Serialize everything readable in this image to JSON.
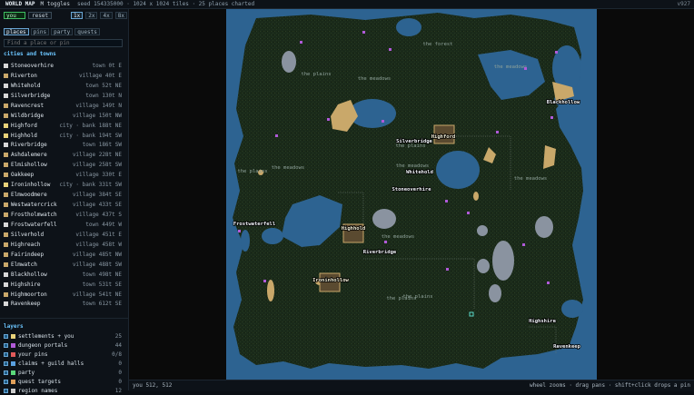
{
  "topbar": {
    "title": "WORLD MAP",
    "toggles": "M toggles",
    "seed": "seed 154335000 · 1024 x 1024 tiles · 25 places charted",
    "version": "v927"
  },
  "sidebar": {
    "you_value": "you",
    "reset_label": "reset",
    "zooms": [
      "1x",
      "2x",
      "4x",
      "8x"
    ],
    "active_zoom": 0,
    "tabs": [
      "places",
      "pins",
      "party",
      "quests"
    ],
    "active_tab": 0,
    "search_placeholder": "Find a place or pin",
    "places_heading": "cities and towns",
    "places": [
      {
        "name": "Stoneoverhire",
        "meta": "town 0t E",
        "color": "#d7d7d7"
      },
      {
        "name": "Riverton",
        "meta": "village 40t E",
        "color": "#c9a86a"
      },
      {
        "name": "Whitehold",
        "meta": "town 52t NE",
        "color": "#d7d7d7"
      },
      {
        "name": "Silverbridge",
        "meta": "town 130t N",
        "color": "#d7d7d7"
      },
      {
        "name": "Ravencrest",
        "meta": "village 149t N",
        "color": "#c9a86a"
      },
      {
        "name": "Wildbridge",
        "meta": "village 150t NW",
        "color": "#c9a86a"
      },
      {
        "name": "Highford",
        "meta": "city · bank 188t NE",
        "color": "#e8d27a"
      },
      {
        "name": "Highhold",
        "meta": "city · bank 194t SW",
        "color": "#e8d27a"
      },
      {
        "name": "Riverbridge",
        "meta": "town 186t SW",
        "color": "#d7d7d7"
      },
      {
        "name": "Ashdalemere",
        "meta": "village 228t NE",
        "color": "#c9a86a"
      },
      {
        "name": "Elmishollow",
        "meta": "village 258t SW",
        "color": "#c9a86a"
      },
      {
        "name": "Oakkeep",
        "meta": "village 330t E",
        "color": "#c9a86a"
      },
      {
        "name": "Ironinhollow",
        "meta": "city · bank 331t SW",
        "color": "#e8d27a"
      },
      {
        "name": "Elmwoodmere",
        "meta": "village 384t SE",
        "color": "#c9a86a"
      },
      {
        "name": "Westwatercrick",
        "meta": "village 433t SE",
        "color": "#c9a86a"
      },
      {
        "name": "Frostholmwatch",
        "meta": "village 437t S",
        "color": "#c9a86a"
      },
      {
        "name": "Frostwaterfell",
        "meta": "town 449t W",
        "color": "#d7d7d7"
      },
      {
        "name": "Silverhold",
        "meta": "village 451t E",
        "color": "#c9a86a"
      },
      {
        "name": "Highreach",
        "meta": "village 458t W",
        "color": "#c9a86a"
      },
      {
        "name": "Fairindeep",
        "meta": "village 485t NW",
        "color": "#c9a86a"
      },
      {
        "name": "Elmwatch",
        "meta": "village 488t SW",
        "color": "#c9a86a"
      },
      {
        "name": "Blackhollow",
        "meta": "town 498t NE",
        "color": "#d7d7d7"
      },
      {
        "name": "Highshire",
        "meta": "town 531t SE",
        "color": "#d7d7d7"
      },
      {
        "name": "Highmoorton",
        "meta": "village 541t NE",
        "color": "#c9a86a"
      },
      {
        "name": "Ravenkeep",
        "meta": "town 612t SE",
        "color": "#d7d7d7"
      }
    ],
    "layers_heading": "layers",
    "layers": [
      {
        "name": "settlements + you",
        "count": "25",
        "color": "#e8d27a"
      },
      {
        "name": "dungeon portals",
        "count": "44",
        "color": "#b05ad8"
      },
      {
        "name": "your pins",
        "count": "0/8",
        "color": "#e05a5a"
      },
      {
        "name": "claims + guild halls",
        "count": "0",
        "color": "#5aa0e0"
      },
      {
        "name": "party",
        "count": "0",
        "color": "#5ad87a"
      },
      {
        "name": "quest targets",
        "count": "0",
        "color": "#e0a05a"
      },
      {
        "name": "region names",
        "count": "12",
        "color": "#cccccc"
      }
    ]
  },
  "map": {
    "labels": [
      {
        "text": "the forest",
        "kind": "region"
      },
      {
        "text": "the plains",
        "kind": "region"
      },
      {
        "text": "the meadows",
        "kind": "region"
      },
      {
        "text": "the meadows",
        "kind": "region"
      },
      {
        "text": "the plains",
        "kind": "region"
      },
      {
        "text": "the plains",
        "kind": "region"
      },
      {
        "text": "the meadows",
        "kind": "region"
      },
      {
        "text": "the meadows",
        "kind": "region"
      },
      {
        "text": "the meadows",
        "kind": "region"
      },
      {
        "text": "the meadows",
        "kind": "region"
      },
      {
        "text": "the plains",
        "kind": "region"
      },
      {
        "text": "the plains",
        "kind": "region"
      },
      {
        "text": "Blackhollow",
        "kind": "town"
      },
      {
        "text": "Highford",
        "kind": "city"
      },
      {
        "text": "Silverbridge",
        "kind": "town"
      },
      {
        "text": "Whitehold",
        "kind": "town"
      },
      {
        "text": "Stoneoverhire",
        "kind": "town"
      },
      {
        "text": "Frostwaterfell",
        "kind": "town"
      },
      {
        "text": "Highhold",
        "kind": "city"
      },
      {
        "text": "Riverbridge",
        "kind": "town"
      },
      {
        "text": "Ironinhollow",
        "kind": "city"
      },
      {
        "text": "Highshire",
        "kind": "town"
      },
      {
        "text": "Ravenkeep",
        "kind": "town"
      }
    ],
    "colors": {
      "land": "#1a2a1a",
      "water": "#2d6391",
      "sand": "#c9a86a",
      "mountain": "#8a93a0",
      "void": "#0a0a0a"
    }
  },
  "bottombar": {
    "position": "you 512, 512",
    "hint": "wheel zooms · drag pans · shift+click drops a pin"
  }
}
